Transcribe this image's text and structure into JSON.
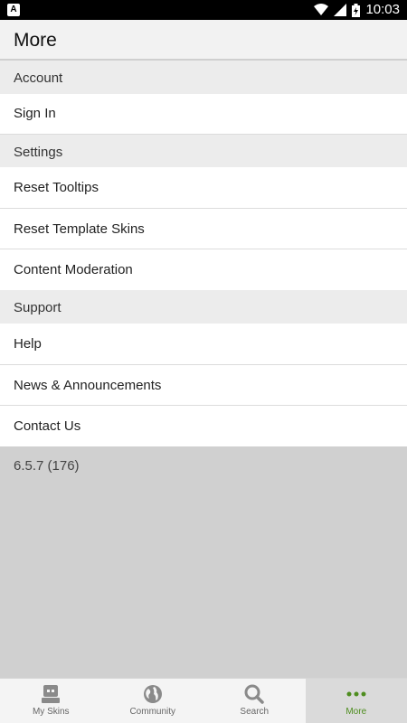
{
  "statusbar": {
    "time": "10:03",
    "app_badge": "A"
  },
  "appbar": {
    "title": "More"
  },
  "sections": {
    "account": {
      "header": "Account",
      "items": [
        "Sign In"
      ]
    },
    "settings": {
      "header": "Settings",
      "items": [
        "Reset Tooltips",
        "Reset Template Skins",
        "Content Moderation"
      ]
    },
    "support": {
      "header": "Support",
      "items": [
        "Help",
        "News & Announcements",
        "Contact Us"
      ]
    }
  },
  "version": "6.5.7 (176)",
  "tabs": [
    {
      "label": "My Skins",
      "icon": "skin-icon"
    },
    {
      "label": "Community",
      "icon": "globe-icon"
    },
    {
      "label": "Search",
      "icon": "search-icon"
    },
    {
      "label": "More",
      "icon": "more-dots-icon"
    }
  ],
  "colors": {
    "accent": "#4e8d1f",
    "statusbar": "#000000"
  }
}
